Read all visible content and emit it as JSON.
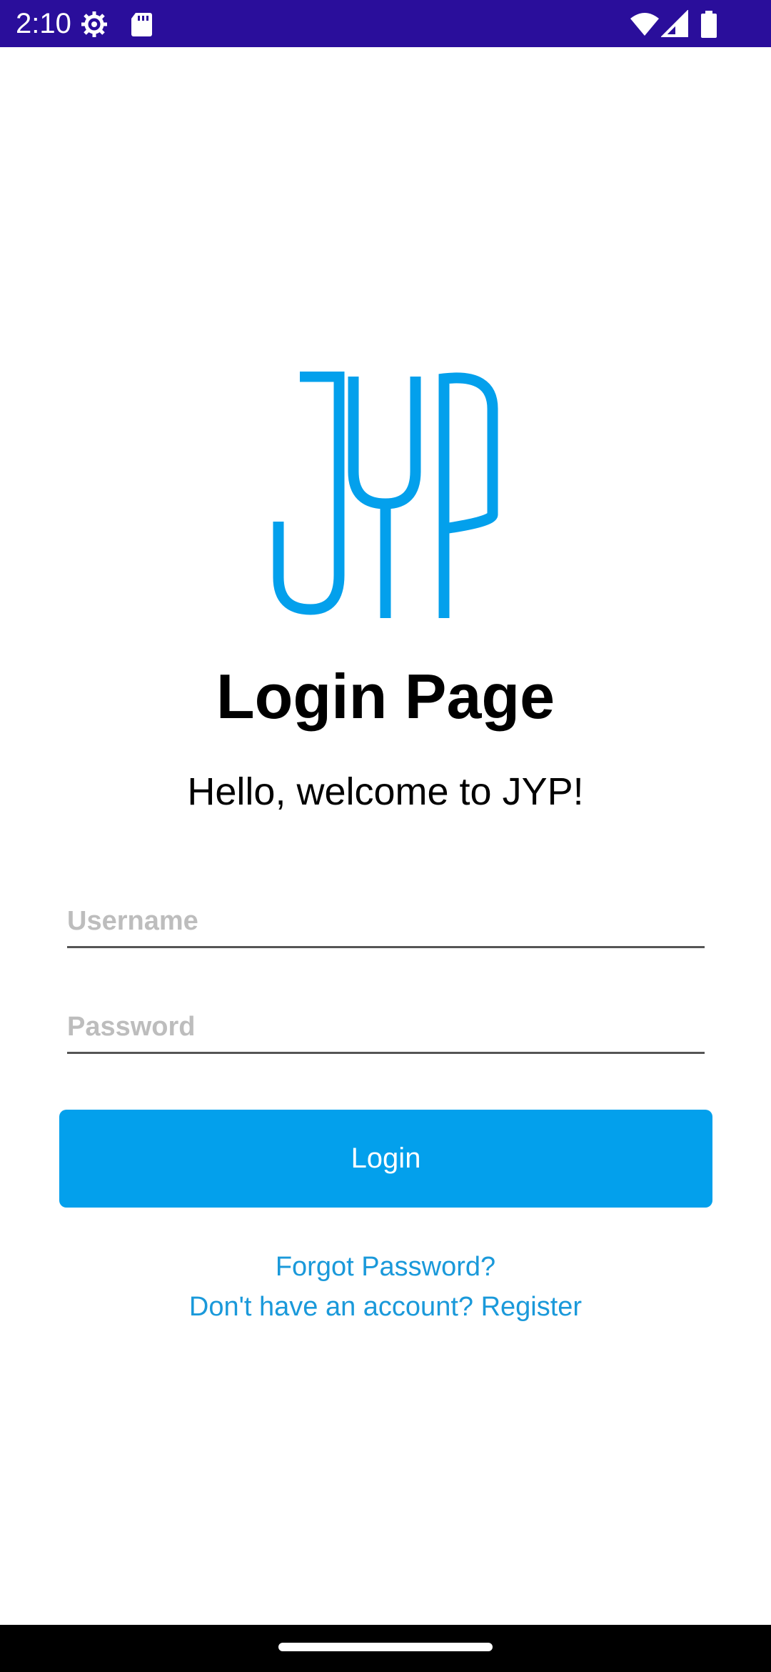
{
  "status_bar": {
    "time": "2:10",
    "background_color": "#2a0e9b",
    "left_icons": [
      "settings-icon",
      "sd-card-icon"
    ],
    "right_icons": [
      "wifi-icon",
      "cellular-signal-icon",
      "battery-icon"
    ]
  },
  "logo": {
    "text": "JYP",
    "color": "#03a0ec"
  },
  "header": {
    "title": "Login Page",
    "subtitle": "Hello, welcome to JYP!"
  },
  "form": {
    "username": {
      "value": "",
      "placeholder": "Username"
    },
    "password": {
      "value": "",
      "placeholder": "Password"
    },
    "login_label": "Login",
    "accent_color": "#03a0ec"
  },
  "links": {
    "forgot_password": "Forgot Password?",
    "register": "Don't have an account? Register",
    "color": "#1a99da"
  }
}
